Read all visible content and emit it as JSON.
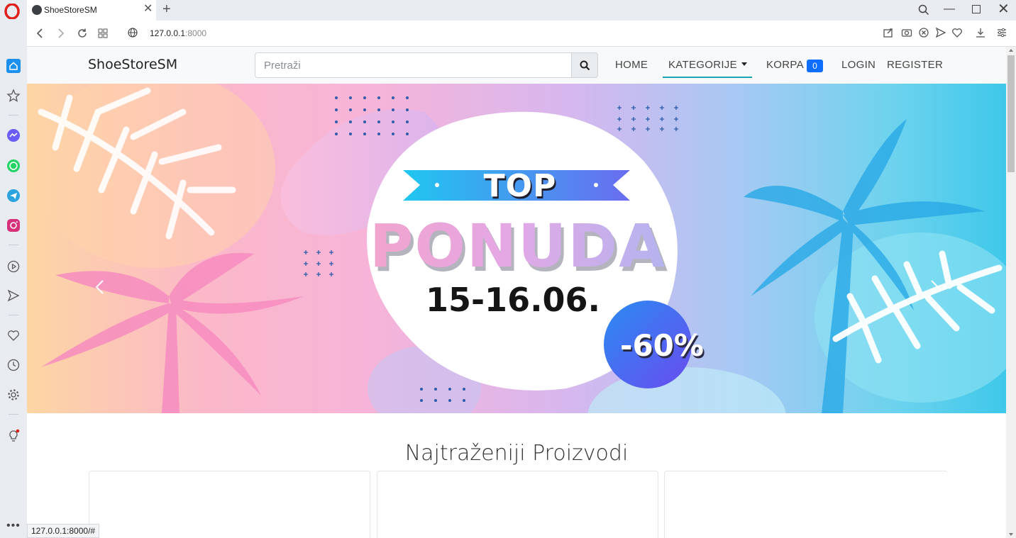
{
  "browser": {
    "tab_title": "ShoeStoreSM",
    "tab_close": "✕",
    "new_tab": "+",
    "url_host": "127.0.0.1",
    "url_port": ":8000",
    "status_url": "127.0.0.1:8000/#",
    "window_min": "—",
    "window_close": "✕",
    "more": "•••"
  },
  "navbar": {
    "brand": "ShoeStoreSM",
    "search_placeholder": "Pretraži",
    "home": "HOME",
    "categories": "KATEGORIJE",
    "cart": "KORPA",
    "cart_count": "0",
    "login": "LOGIN",
    "register": "REGISTER"
  },
  "hero": {
    "ribbon": "TOP",
    "title": "PONUDA",
    "date": "15-16.06.",
    "discount": "-60%",
    "active_slide": 1,
    "slide_count": 3
  },
  "products": {
    "section_title": "Najtraženiji Proizvodi"
  }
}
